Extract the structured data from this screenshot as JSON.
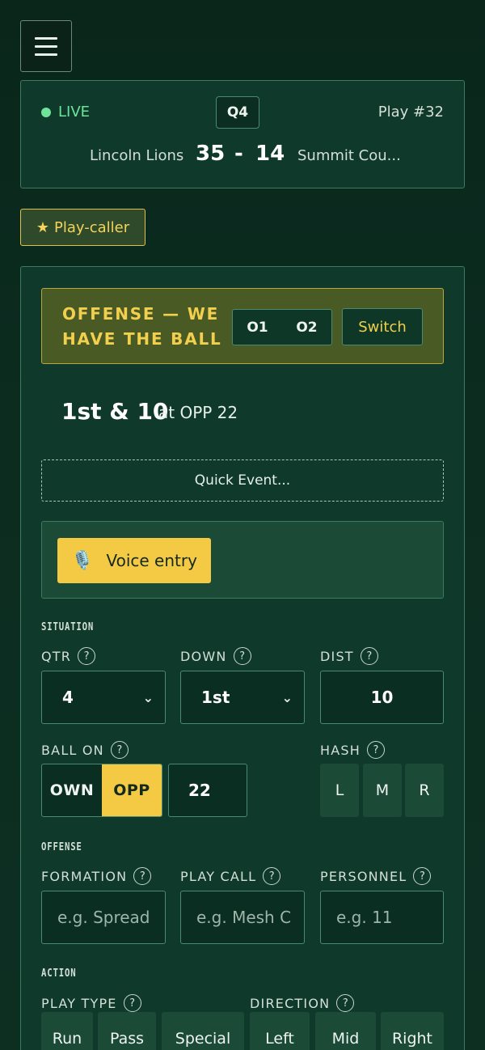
{
  "header": {
    "menu_icon": "hamburger-icon"
  },
  "game": {
    "live_label": "LIVE",
    "quarter": "Q4",
    "play_number": "Play #32",
    "home_team": "Lincoln Lions",
    "home_score": "35",
    "separator": "-",
    "away_score": "14",
    "away_team": "Summit Cou..."
  },
  "role": {
    "icon": "★",
    "label": "Play-caller"
  },
  "possession": {
    "title": "OFFENSE — WE HAVE THE BALL",
    "options": [
      "O1",
      "O2"
    ],
    "switch_label": "Switch"
  },
  "situation_summary": {
    "down_distance": "1st & 10",
    "spot": "at OPP 22"
  },
  "quick_event": {
    "label": "Quick Event..."
  },
  "voice": {
    "icon": "🎙️",
    "label": "Voice entry"
  },
  "situation": {
    "section_label": "SITUATION",
    "qtr": {
      "label": "QTR",
      "value": "4"
    },
    "down": {
      "label": "DOWN",
      "value": "1st"
    },
    "dist": {
      "label": "DIST",
      "value": "10"
    },
    "ball_on": {
      "label": "BALL ON",
      "own": "OWN",
      "opp": "OPP",
      "selected": "OPP",
      "yard": "22"
    },
    "hash": {
      "label": "HASH",
      "options": [
        "L",
        "M",
        "R"
      ]
    }
  },
  "offense": {
    "section_label": "OFFENSE",
    "formation": {
      "label": "FORMATION",
      "placeholder": "e.g. Spread"
    },
    "play_call": {
      "label": "PLAY CALL",
      "placeholder": "e.g. Mesh C"
    },
    "personnel": {
      "label": "PERSONNEL",
      "placeholder": "e.g. 11"
    }
  },
  "action": {
    "section_label": "ACTION",
    "play_type": {
      "label": "PLAY TYPE",
      "options": [
        "Run",
        "Pass",
        "Special"
      ]
    },
    "direction": {
      "label": "DIRECTION",
      "options": [
        "Left",
        "Mid",
        "Right"
      ]
    }
  },
  "help_glyph": "?",
  "chevron_glyph": "⌄"
}
